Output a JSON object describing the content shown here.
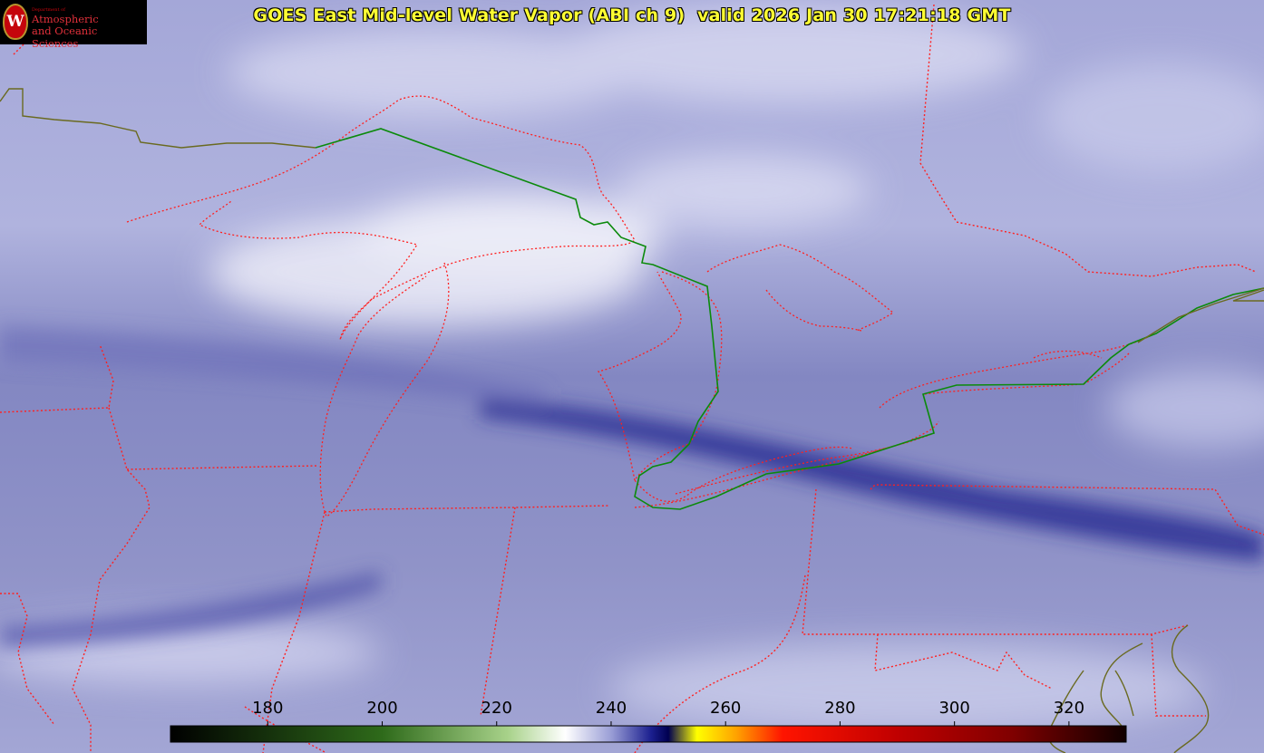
{
  "title": "GOES East Mid-level Water Vapor (ABI ch 9)  valid 2026 Jan 30 17:21:18 GMT",
  "logo": {
    "seal_letter": "W",
    "department": "Department of",
    "line1": "Atmospheric",
    "line2": "and Oceanic Sciences"
  },
  "colorbar": {
    "min": 163,
    "max": 330,
    "tick_labels": [
      180,
      200,
      220,
      240,
      260,
      280,
      300,
      320
    ],
    "stops": [
      {
        "value": 163,
        "color": "#000000"
      },
      {
        "value": 200,
        "color": "#2e6a1a"
      },
      {
        "value": 222,
        "color": "#a8d28a"
      },
      {
        "value": 232,
        "color": "#ffffff"
      },
      {
        "value": 240,
        "color": "#9a9ed6"
      },
      {
        "value": 247,
        "color": "#1b1f8f"
      },
      {
        "value": 250,
        "color": "#000050"
      },
      {
        "value": 255,
        "color": "#ffff00"
      },
      {
        "value": 262,
        "color": "#ffa000"
      },
      {
        "value": 270,
        "color": "#ff1400"
      },
      {
        "value": 290,
        "color": "#c00000"
      },
      {
        "value": 310,
        "color": "#800000"
      },
      {
        "value": 330,
        "color": "#100000"
      }
    ]
  },
  "colors": {
    "background": "#8f92c8",
    "state_border": "#ff2020",
    "international_border": "#0b8a0b",
    "coastline": "#5a5a20",
    "title_text": "#ffff33",
    "brand_red": "#c5050c"
  }
}
